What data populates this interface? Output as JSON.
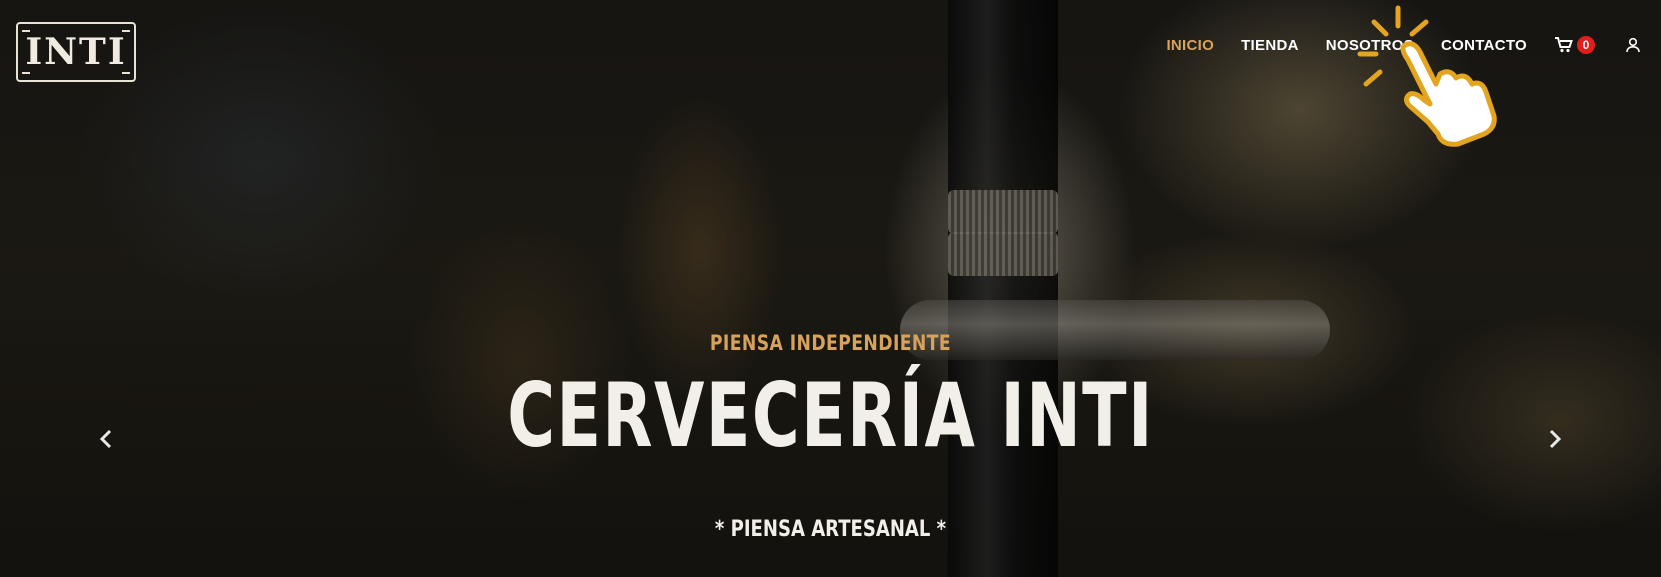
{
  "brand": {
    "logo_text": "INTI"
  },
  "nav": {
    "items": [
      {
        "label": "INICIO",
        "active": true
      },
      {
        "label": "TIENDA",
        "active": false
      },
      {
        "label": "NOSOTROS",
        "active": false
      },
      {
        "label": "CONTACTO",
        "active": false
      }
    ],
    "cart_count": "0",
    "cart_icon": "cart-icon",
    "user_icon": "user-icon"
  },
  "hero": {
    "kicker": "PIENSA INDEPENDIENTE",
    "title": "CERVECERÍA INTI",
    "tagline": "* PIENSA ARTESANAL *"
  },
  "carousel": {
    "prev_icon": "chevron-left-icon",
    "next_icon": "chevron-right-icon"
  },
  "overlay_icon": "hand-pointer-icon",
  "colors": {
    "accent": "#d6a25c",
    "badge": "#e11d1d",
    "text": "#f2efe8"
  }
}
